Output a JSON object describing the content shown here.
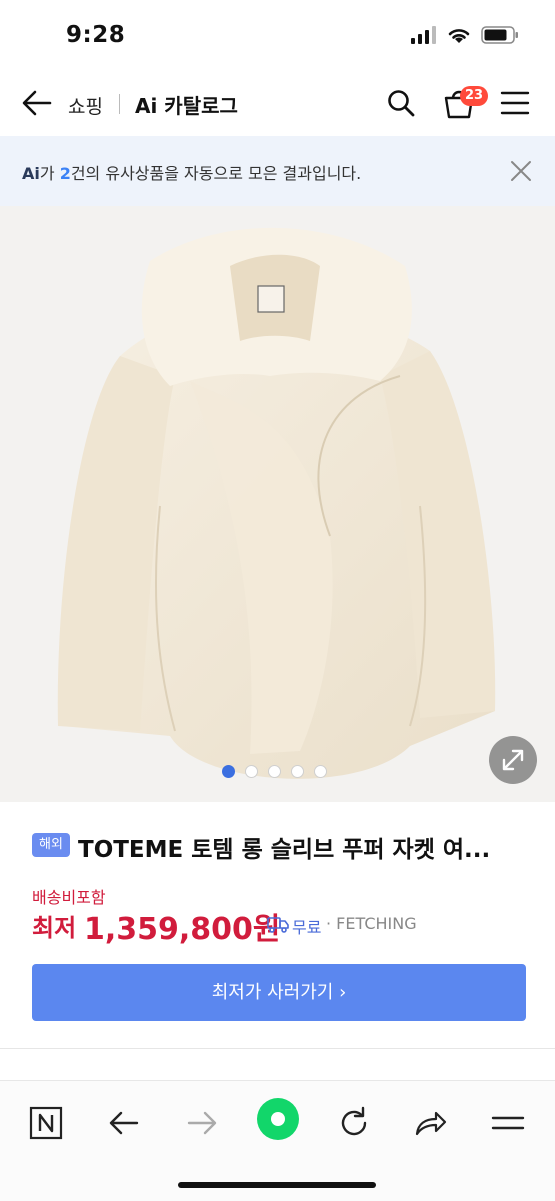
{
  "status": {
    "time": "9:28"
  },
  "nav": {
    "shop_label": "쇼핑",
    "ai_catalog_label": "Ai 카탈로그",
    "cart_count": "23"
  },
  "banner": {
    "ai_logo": "Ai",
    "text_part1": "가 ",
    "count": "2",
    "text_part2": "건의 유사상품을 자동으로 모은 결과입니다."
  },
  "product": {
    "tag": "해외",
    "title": "TOTEME 토템 롱 슬리브 푸퍼 자켓 여...",
    "shipping_included": "배송비포함",
    "price_prefix": "최저",
    "price": "1,359,800원",
    "shipping_free": "무료",
    "seller": "· FETCHING",
    "image_slides": 5,
    "active_slide": 1
  },
  "actions": {
    "buy_label": "최저가 사러가기 ›"
  },
  "colors": {
    "accent": "#5b87ef",
    "price": "#d11c3c",
    "badge": "#ff4a3b",
    "banner_bg": "#eef3fb"
  }
}
